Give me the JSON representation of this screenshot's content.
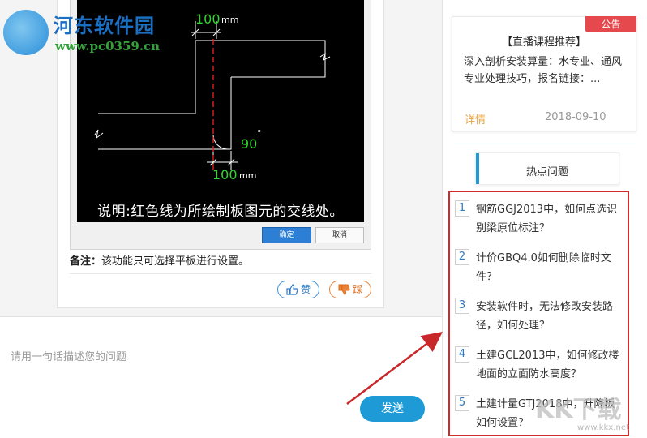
{
  "watermark": {
    "name": "河东软件园",
    "url": "www.pc0359.cn",
    "corner": "KK下载",
    "corner_url": "www.kkx.net"
  },
  "cad": {
    "dim_top": "100",
    "dim_top_unit": "mm",
    "dim_bottom": "100",
    "dim_bottom_unit": "mm",
    "angle": "90",
    "angle_unit": "°",
    "caption": "说明:红色线为所绘制板图元的交线处。"
  },
  "dialog": {
    "ok_label": "确定",
    "cancel_label": "取消"
  },
  "note": {
    "prefix": "备注：",
    "text": "该功能只可选择平板进行设置。"
  },
  "feedback": {
    "like_label": "赞",
    "dislike_label": "踩"
  },
  "ask": {
    "placeholder": "请用一句话描述您的问题",
    "send_label": "发送"
  },
  "notice": {
    "badge": "公告",
    "title": "【直播课程推荐】",
    "body": "深入剖析安装算量：水专业、通风专业处理技巧，报名链接：...",
    "detail_label": "详情",
    "date": "2018-09-10"
  },
  "hot": {
    "tab_label": "热点问题",
    "items": [
      {
        "num": "1",
        "text": "钢筋GGJ2013中，如何点选识别梁原位标注？"
      },
      {
        "num": "2",
        "text": "计价GBQ4.0如何删除临时文件？"
      },
      {
        "num": "3",
        "text": "安装软件时，无法修改安装路径，如何处理？"
      },
      {
        "num": "4",
        "text": "土建GCL2013中，如何修改楼地面的立面防水高度？"
      },
      {
        "num": "5",
        "text": "土建计量GTJ2018中，升降板如何设置？"
      }
    ]
  },
  "colors": {
    "accent": "#1e9ad6",
    "highlight_border": "#d02a2a",
    "badge": "#e5484d",
    "detail": "#e8a13a"
  }
}
